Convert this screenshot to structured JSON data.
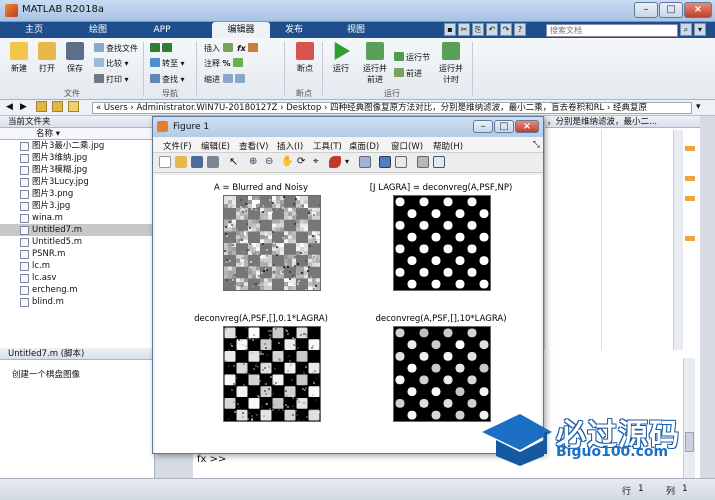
{
  "window": {
    "title": "MATLAB R2018a"
  },
  "tabs": [
    {
      "label": "主页"
    },
    {
      "label": "绘图"
    },
    {
      "label": "APP"
    },
    {
      "label": "编辑器"
    },
    {
      "label": "发布"
    },
    {
      "label": "视图"
    }
  ],
  "search": {
    "placeholder": "搜索文档"
  },
  "ribbon": {
    "new": "新建",
    "open": "打开",
    "save": "保存",
    "find_files": "查找文件",
    "compare": "比较",
    "print": "打印",
    "insert": "插入",
    "comment": "注释",
    "indent": "缩进",
    "goto": "转至",
    "find": "查找",
    "breakpoints": "断点",
    "run": "运行",
    "run_advance_1": "运行并",
    "run_advance_2": "前进",
    "run_section": "运行节",
    "advance": "前进",
    "run_time_1": "运行并",
    "run_time_2": "计时",
    "group_file": "文件",
    "group_nav": "导航",
    "group_bp": "断点",
    "group_run": "运行"
  },
  "address": {
    "path": "« Users › Administrator.WIN7U-20180127Z › Desktop › 四种经典图像复原方法对比，分别是维纳滤波，最小二乘，盲去卷积和RL › 经典复原"
  },
  "current_folder": {
    "title": "当前文件夹",
    "col_name": "名称",
    "files": [
      "图片3最小二乘.jpg",
      "图片3维纳.jpg",
      "图片3模糊.jpg",
      "图片3Lucy.jpg",
      "图片3.png",
      "图片3.jpg",
      "wina.m",
      "Untitled7.m",
      "Untitled5.m",
      "PSNR.m",
      "lc.m",
      "lc.asv",
      "ercheng.m",
      "blind.m"
    ],
    "selected_index": 7
  },
  "details": {
    "title": "Untitled7.m  (脚本)",
    "text": "创建一个棋盘图像"
  },
  "right_partial": "，分别是维纳滤波，最小二...",
  "command": {
    "prompt": "fx >>"
  },
  "status": {
    "line_label": "行",
    "line_value": "1",
    "col_label": "列",
    "col_value": "1"
  },
  "figure": {
    "title": "Figure 1",
    "menus": [
      "文件(F)",
      "编辑(E)",
      "查看(V)",
      "插入(I)",
      "工具(T)",
      "桌面(D)",
      "窗口(W)",
      "帮助(H)"
    ],
    "subplots": [
      {
        "title": "A = Blurred and Noisy"
      },
      {
        "title": "[J LAGRA] = deconvreg(A,PSF,NP)"
      },
      {
        "title": "deconvreg(A,PSF,[],0.1*LAGRA)"
      },
      {
        "title": "deconvreg(A,PSF,[],10*LAGRA)"
      }
    ]
  },
  "watermark": {
    "cn": "必过源码",
    "en": "Biguo100.com"
  }
}
